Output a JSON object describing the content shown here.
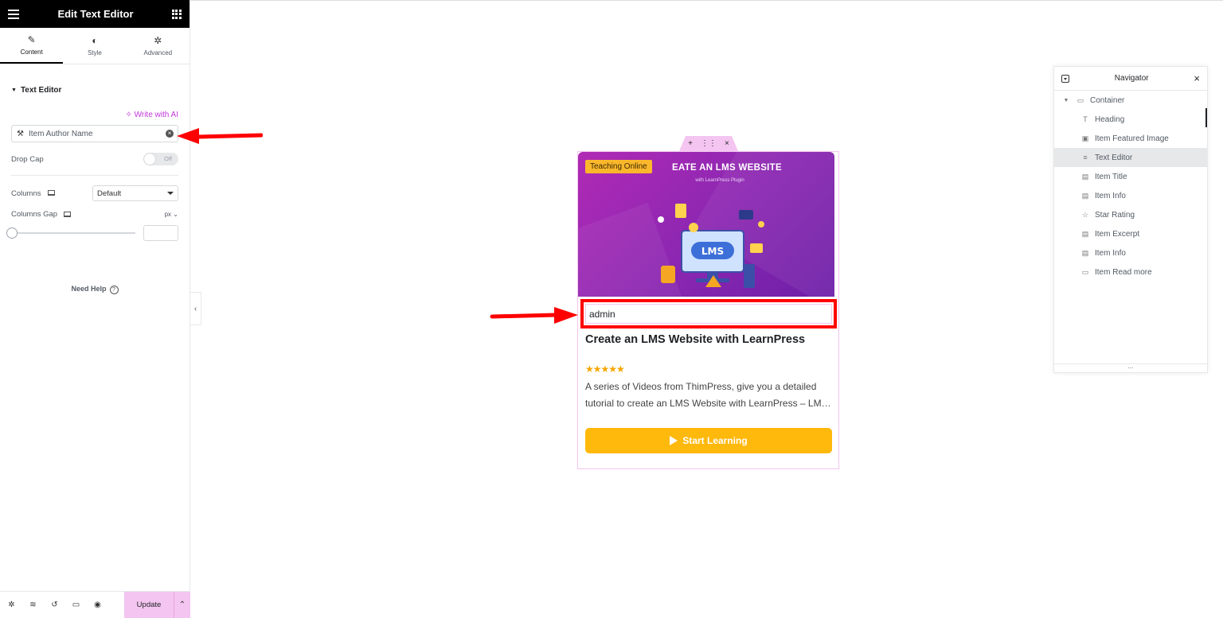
{
  "panel": {
    "title": "Edit Text Editor",
    "tabs": [
      {
        "label": "Content",
        "icon": "pencil-icon"
      },
      {
        "label": "Style",
        "icon": "half-circle-icon"
      },
      {
        "label": "Advanced",
        "icon": "gear-icon"
      }
    ],
    "section_title": "Text Editor",
    "write_ai": "Write with AI",
    "dynamic_tag": "Item Author Name",
    "drop_cap_label": "Drop Cap",
    "drop_cap_toggle": "Off",
    "columns_label": "Columns",
    "columns_value": "Default",
    "columns_gap_label": "Columns Gap",
    "columns_gap_unit": "px",
    "need_help": "Need Help",
    "update": "Update"
  },
  "card": {
    "badge": "Teaching Online",
    "hero_title": "EATE AN LMS WEBSITE",
    "hero_subtitle": "with LearnPress Plugin",
    "hero_logo": "LMS",
    "author": "admin",
    "title": "Create an LMS Website with LearnPress",
    "rating": "★★★★★",
    "excerpt": "A series of Videos from ThimPress, give you a detailed tutorial to create an LMS Website with LearnPress – LM…",
    "button": "Start Learning"
  },
  "navigator": {
    "title": "Navigator",
    "root": "Container",
    "items": [
      {
        "label": "Heading",
        "icon": "heading-icon"
      },
      {
        "label": "Item Featured Image",
        "icon": "image-icon"
      },
      {
        "label": "Text Editor",
        "icon": "text-editor-icon",
        "active": true
      },
      {
        "label": "Item Title",
        "icon": "document-icon"
      },
      {
        "label": "Item Info",
        "icon": "document-icon"
      },
      {
        "label": "Star Rating",
        "icon": "star-rating-icon"
      },
      {
        "label": "Item Excerpt",
        "icon": "document-icon"
      },
      {
        "label": "Item Info",
        "icon": "document-icon"
      },
      {
        "label": "Item Read more",
        "icon": "button-icon"
      }
    ],
    "footer": "..."
  },
  "colors": {
    "accent_pink": "#f4c5f0",
    "ai_purple": "#c036d8",
    "highlight_red": "#ff0000",
    "button_yellow": "#ffb80c"
  }
}
